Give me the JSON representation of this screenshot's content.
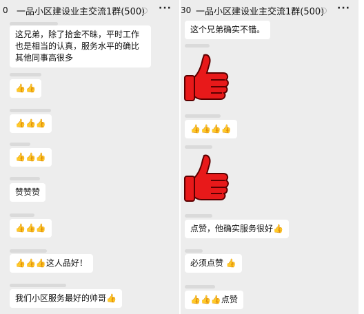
{
  "left": {
    "title": "一品小区建设业主交流1群(500)",
    "badge": "0",
    "more": "···",
    "messages": [
      {
        "text": "这兄弟，除了拾金不昧，平时工作也是相当的认真，服务水平的确比其他同事高很多"
      },
      {
        "text": "👍👍"
      },
      {
        "text": "👍👍👍"
      },
      {
        "text": "👍👍👍"
      },
      {
        "text": "赞赞赞"
      },
      {
        "text": "👍👍👍"
      },
      {
        "text": "👍👍👍这人品好！"
      },
      {
        "text": "我们小区服务最好的帅哥👍"
      }
    ]
  },
  "right": {
    "title": "一品小区建设业主交流1群(500)",
    "badge": "30",
    "more": "···",
    "messages": [
      {
        "text": "这个兄弟确实不错。"
      },
      {
        "text": "👍👍👍👍"
      },
      {
        "text": "点赞，他确实服务很好👍"
      },
      {
        "text": "必须点赞 👍"
      },
      {
        "text": "👍👍👍点赞"
      }
    ]
  },
  "colors": {
    "thumb_red": "#e8191a",
    "thumb_outline": "#5a0000",
    "chat_bg": "#ededed",
    "bubble_bg": "#ffffff"
  }
}
